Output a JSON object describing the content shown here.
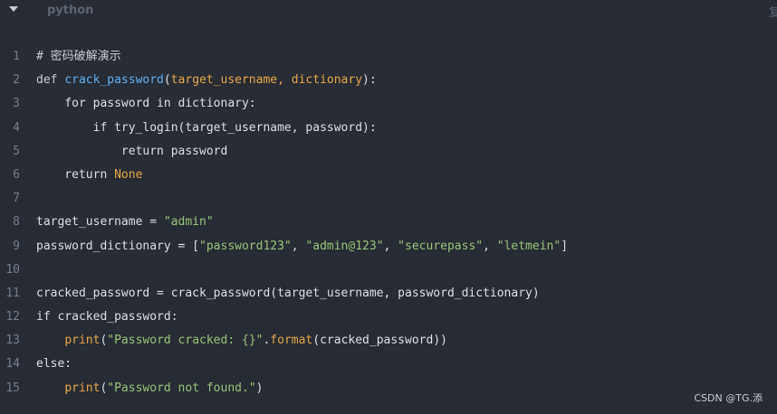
{
  "header": {
    "language": "python",
    "copy_label": "复制"
  },
  "code": {
    "lines": [
      {
        "n": "1",
        "tokens": [
          {
            "t": "# 密码破解演示",
            "c": "comment"
          }
        ]
      },
      {
        "n": "2",
        "tokens": [
          {
            "t": "def ",
            "c": "kw"
          },
          {
            "t": "crack_password",
            "c": "fn"
          },
          {
            "t": "(",
            "c": ""
          },
          {
            "t": "target_username, dictionary",
            "c": "param"
          },
          {
            "t": "):",
            "c": ""
          }
        ]
      },
      {
        "n": "3",
        "tokens": [
          {
            "t": "    for password in dictionary:",
            "c": ""
          }
        ]
      },
      {
        "n": "4",
        "tokens": [
          {
            "t": "        if try_login(target_username, password):",
            "c": ""
          }
        ]
      },
      {
        "n": "5",
        "tokens": [
          {
            "t": "            return password",
            "c": ""
          }
        ]
      },
      {
        "n": "6",
        "tokens": [
          {
            "t": "    return ",
            "c": ""
          },
          {
            "t": "None",
            "c": "none"
          }
        ]
      },
      {
        "n": "7",
        "tokens": []
      },
      {
        "n": "8",
        "tokens": [
          {
            "t": "target_username = ",
            "c": ""
          },
          {
            "t": "\"admin\"",
            "c": "str"
          }
        ]
      },
      {
        "n": "9",
        "tokens": [
          {
            "t": "password_dictionary = [",
            "c": ""
          },
          {
            "t": "\"password123\"",
            "c": "str"
          },
          {
            "t": ", ",
            "c": ""
          },
          {
            "t": "\"admin@123\"",
            "c": "str"
          },
          {
            "t": ", ",
            "c": ""
          },
          {
            "t": "\"securepass\"",
            "c": "str"
          },
          {
            "t": ", ",
            "c": ""
          },
          {
            "t": "\"letmein\"",
            "c": "str"
          },
          {
            "t": "]",
            "c": ""
          }
        ]
      },
      {
        "n": "10",
        "tokens": []
      },
      {
        "n": "11",
        "tokens": [
          {
            "t": "cracked_password = crack_password(target_username, password_dictionary)",
            "c": ""
          }
        ]
      },
      {
        "n": "12",
        "tokens": [
          {
            "t": "if cracked_password:",
            "c": ""
          }
        ]
      },
      {
        "n": "13",
        "tokens": [
          {
            "t": "    ",
            "c": ""
          },
          {
            "t": "print",
            "c": "builtin"
          },
          {
            "t": "(",
            "c": ""
          },
          {
            "t": "\"Password cracked: {}\"",
            "c": "str"
          },
          {
            "t": ".",
            "c": ""
          },
          {
            "t": "format",
            "c": "builtin"
          },
          {
            "t": "(cracked_password))",
            "c": ""
          }
        ]
      },
      {
        "n": "14",
        "tokens": [
          {
            "t": "else:",
            "c": ""
          }
        ]
      },
      {
        "n": "15",
        "tokens": [
          {
            "t": "    ",
            "c": ""
          },
          {
            "t": "print",
            "c": "builtin"
          },
          {
            "t": "(",
            "c": ""
          },
          {
            "t": "\"Password not found.\"",
            "c": "str"
          },
          {
            "t": ")",
            "c": ""
          }
        ]
      }
    ]
  },
  "watermark": "CSDN @TG.添",
  "colors": {
    "background": "#282c34",
    "function": "#61afef",
    "string": "#98c379",
    "param": "#e5a64b",
    "line_number": "#757c88"
  },
  "icons": {
    "collapse": "caret-down-icon"
  }
}
